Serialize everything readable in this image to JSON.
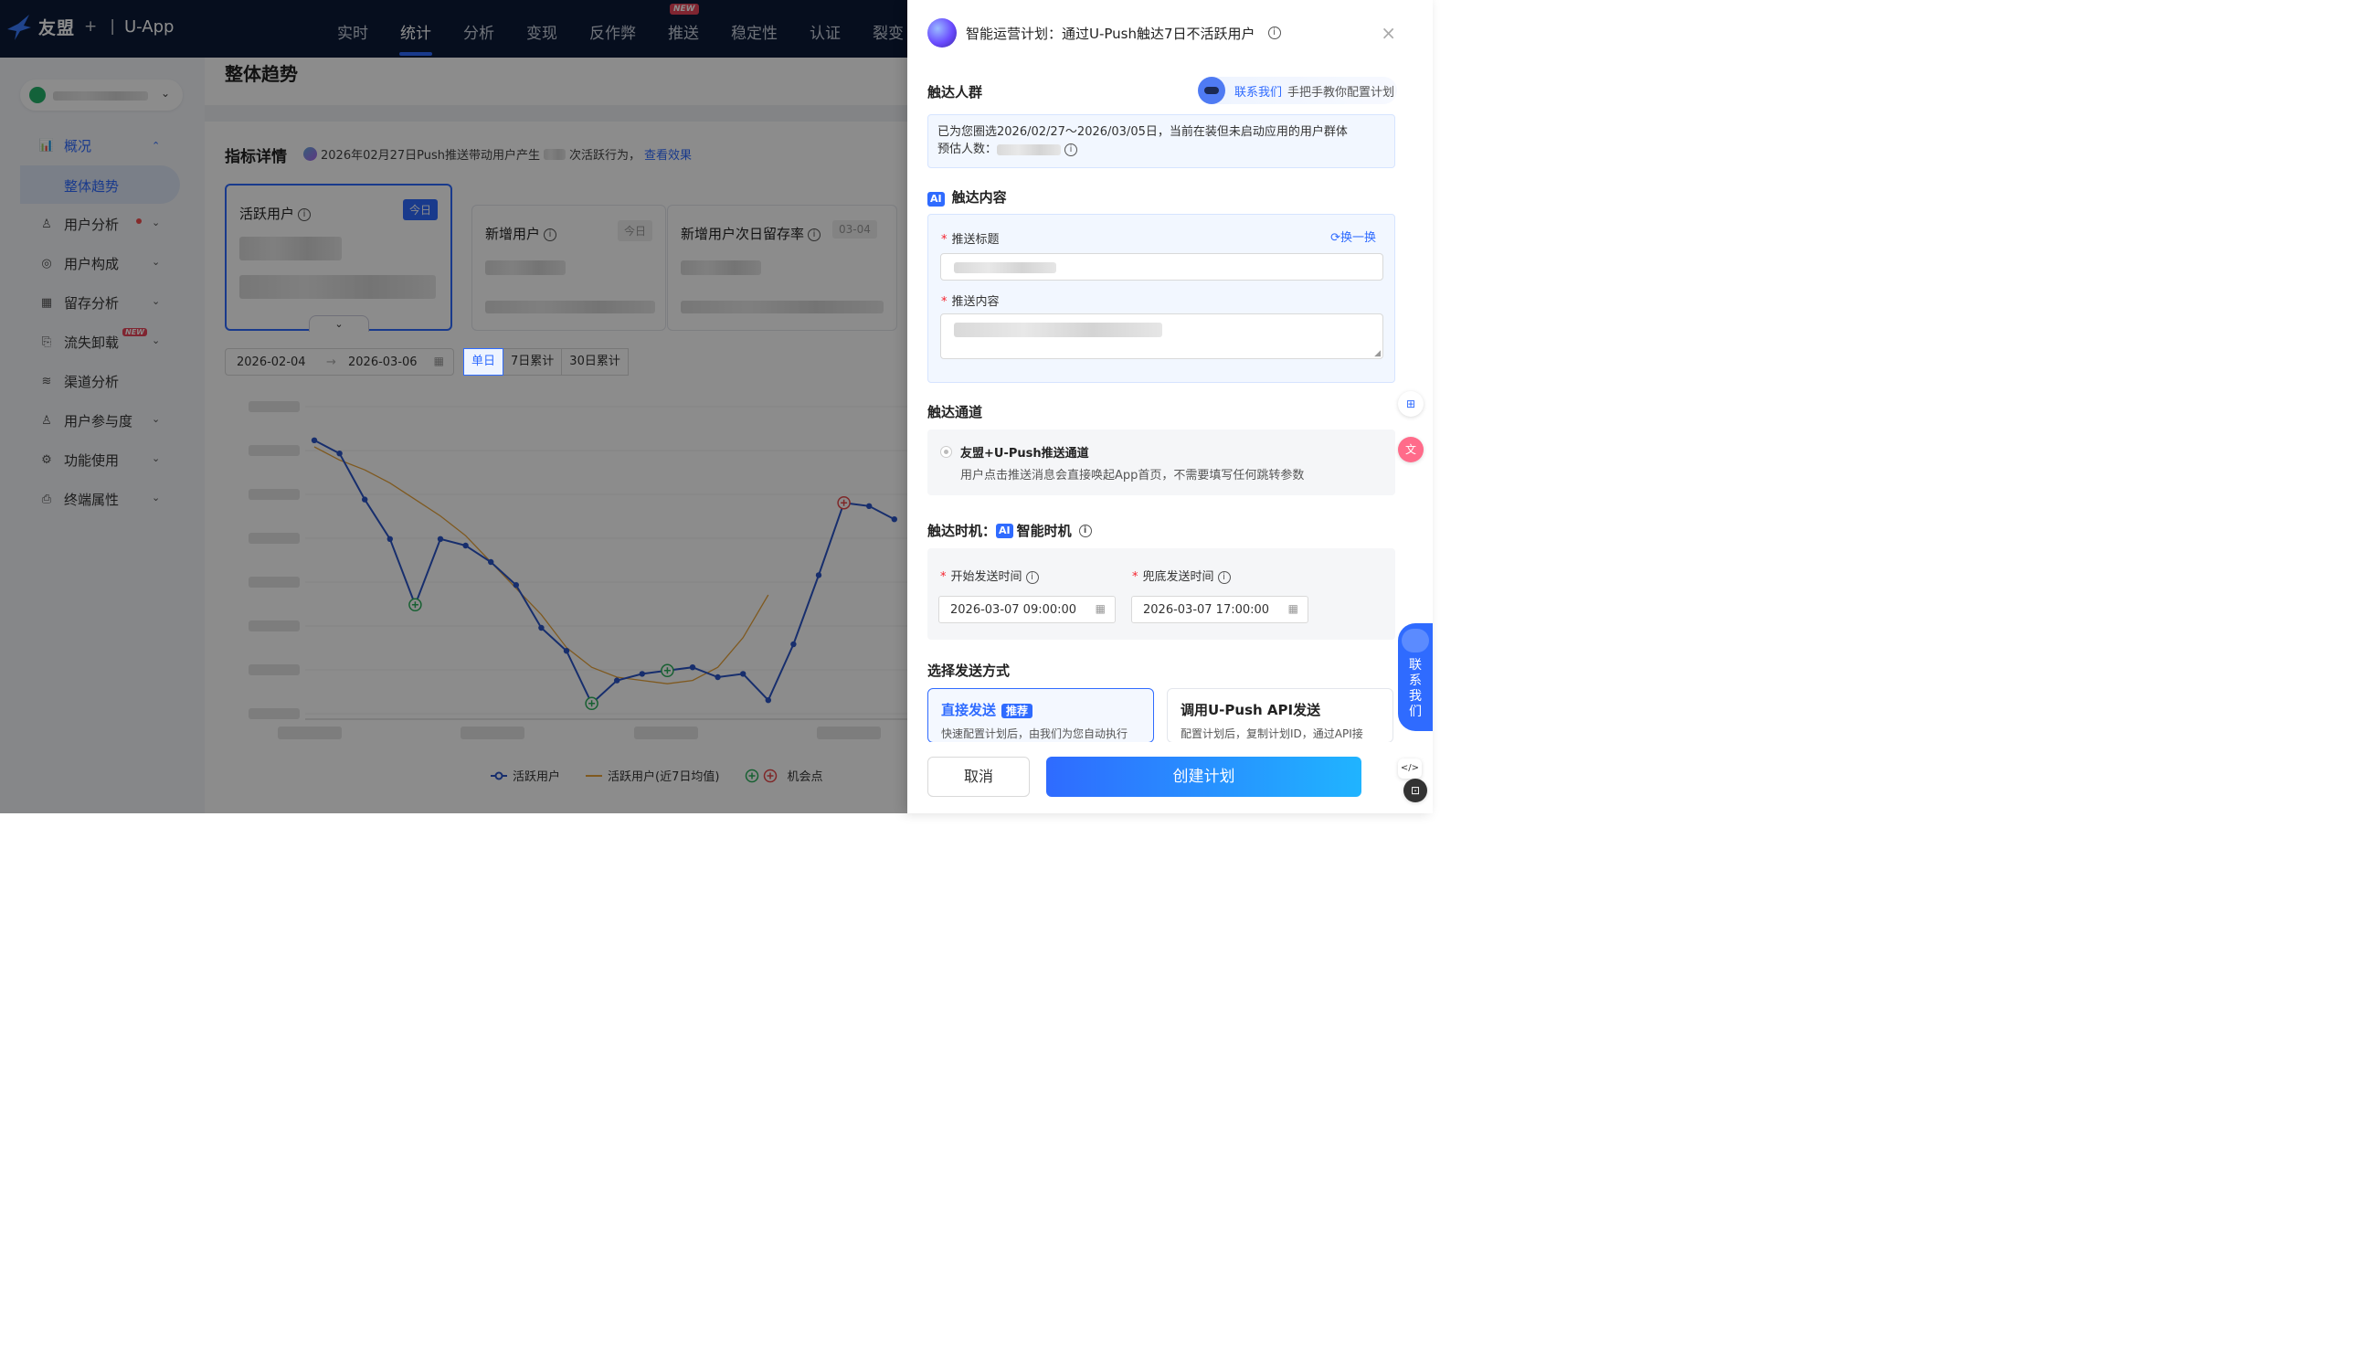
{
  "topnav": {
    "brand": "友盟",
    "plus": "+",
    "app_name": "U-App",
    "items": [
      "实时",
      "统计",
      "分析",
      "变现",
      "反作弊",
      "推送",
      "稳定性",
      "认证",
      "裂变"
    ],
    "active": "统计",
    "new_badge": "NEW"
  },
  "sidebar": {
    "items": [
      {
        "label": "概况",
        "icon": "overview-chart-icon",
        "expanded": true
      },
      {
        "label": "整体趋势",
        "icon": "",
        "selected": true
      },
      {
        "label": "用户分析",
        "icon": "user-analysis-icon",
        "dot": true
      },
      {
        "label": "用户构成",
        "icon": "user-composition-icon"
      },
      {
        "label": "留存分析",
        "icon": "retention-icon"
      },
      {
        "label": "流失卸载",
        "icon": "churn-icon",
        "new_badge": "NEW"
      },
      {
        "label": "渠道分析",
        "icon": "channel-icon"
      },
      {
        "label": "用户参与度",
        "icon": "engagement-icon"
      },
      {
        "label": "功能使用",
        "icon": "feature-gear-icon"
      },
      {
        "label": "终端属性",
        "icon": "device-icon"
      }
    ]
  },
  "main": {
    "page_title": "整体趋势",
    "detail_title": "指标详情",
    "detail_tip_prefix": "2026年02月27日Push推送带动用户产生",
    "detail_tip_suffix": "次活跃行为，",
    "detail_tip_link": "查看效果",
    "kpis": [
      {
        "title": "活跃用户",
        "tag": "今日"
      },
      {
        "title": "新增用户",
        "tag": "今日"
      },
      {
        "title": "新增用户次日留存率",
        "tag": "03-04"
      }
    ],
    "date_start": "2026-02-04",
    "date_arrow": "→",
    "date_end": "2026-03-06",
    "seg": [
      "单日",
      "7日累计",
      "30日累计"
    ],
    "seg_active": "单日"
  },
  "chart_data": {
    "type": "line",
    "series": [
      {
        "name": "活跃用户",
        "color": "#2b55c7",
        "values": [
          0.92,
          0.88,
          0.74,
          0.62,
          0.42,
          0.62,
          0.6,
          0.55,
          0.48,
          0.35,
          0.28,
          0.12,
          0.19,
          0.21,
          0.22,
          0.23,
          0.2,
          0.21,
          0.13,
          0.3,
          0.51,
          0.73,
          0.72,
          0.68
        ]
      },
      {
        "name": "活跃用户(近7日均值)",
        "color": "#e8a33a",
        "values": [
          0.9,
          0.86,
          0.83,
          0.79,
          0.74,
          0.69,
          0.63,
          0.55,
          0.47,
          0.39,
          0.29,
          0.23,
          0.2,
          0.19,
          0.18,
          0.19,
          0.23,
          0.32,
          0.45
        ]
      }
    ],
    "opportunity_points": [
      {
        "index": 4,
        "kind": "good"
      },
      {
        "index": 11,
        "kind": "good"
      },
      {
        "index": 14,
        "kind": "good"
      },
      {
        "index": 21,
        "kind": "bad"
      }
    ],
    "legend": [
      "活跃用户",
      "活跃用户(近7日均值)",
      "机会点"
    ]
  },
  "drawer": {
    "title": "智能运营计划：通过U-Push触达7日不活跃用户",
    "close": "×",
    "audience_title": "触达人群",
    "contact_link": "联系我们",
    "contact_tip": "手把手教你配置计划",
    "audience_text": "已为您圈选2026/02/27～2026/03/05日，当前在装但未启动应用的用户群体",
    "audience_count_label": "预估人数：",
    "ai_label": "AI",
    "content_title": "触达内容",
    "push_title_label": "推送标题",
    "swap_label": "换一换",
    "push_content_label": "推送内容",
    "channel_title": "触达通道",
    "channel_name": "友盟+U-Push推送通道",
    "channel_desc": "用户点击推送消息会直接唤起App首页，不需要填写任何跳转参数",
    "timing_title": "触达时机：",
    "timing_mode": "智能时机",
    "start_label": "开始发送时间",
    "start_value": "2026-03-07 09:00:00",
    "fallback_label": "兜底发送时间",
    "fallback_value": "2026-03-07 17:00:00",
    "send_mode_title": "选择发送方式",
    "modes": [
      {
        "title": "直接发送",
        "badge": "推荐",
        "desc": "快速配置计划后，由我们为您自动执行"
      },
      {
        "title": "调用U-Push API发送",
        "badge": "",
        "desc": "配置计划后，复制计划ID，通过API接"
      }
    ],
    "cancel": "取消",
    "create": "创建计划"
  },
  "float": {
    "contact": "联系我们"
  }
}
